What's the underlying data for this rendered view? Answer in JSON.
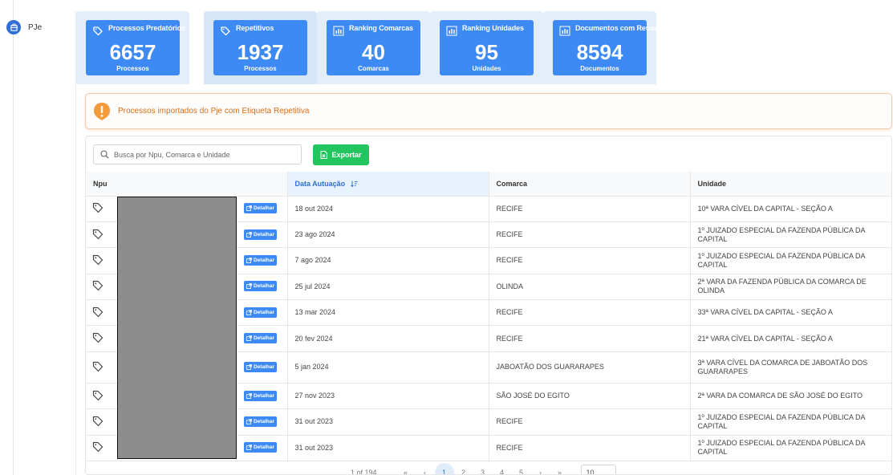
{
  "app": {
    "name": "PJe"
  },
  "tabs": [
    {
      "title": "Processos Predatórios",
      "value": "6657",
      "unit": "Processos",
      "icon": "tag-icon",
      "active": false
    },
    {
      "title": "Repetitivos",
      "value": "1937",
      "unit": "Processos",
      "icon": "tag-icon",
      "active": true
    },
    {
      "title": "Ranking Comarcas",
      "value": "40",
      "unit": "Comarcas",
      "icon": "bar-chart-icon",
      "active": false
    },
    {
      "title": "Ranking Unidades",
      "value": "95",
      "unit": "Unidades",
      "icon": "bar-chart-icon",
      "active": false
    },
    {
      "title": "Documentos com Reuso",
      "value": "8594",
      "unit": "Documentos",
      "icon": "bar-chart-icon",
      "active": false
    }
  ],
  "alert": {
    "text": "Processos importados do Pje com Etiqueta Repetitiva",
    "icon": "exclamation-icon",
    "color": "#d86d17"
  },
  "search": {
    "placeholder": "Busca por Npu, Comarca e Unidade"
  },
  "export_label": "Exportar",
  "table": {
    "columns": [
      "Npu",
      "Data Autuação",
      "Comarca",
      "Unidade"
    ],
    "sorted_column": "Data Autuação",
    "detail_label": "Detalhar",
    "rows": [
      {
        "data": "18 out 2024",
        "comarca": "RECIFE",
        "unidade": "10ª VARA CÍVEL DA CAPITAL - SEÇÃO A"
      },
      {
        "data": "23 ago 2024",
        "comarca": "RECIFE",
        "unidade": "1º JUIZADO ESPECIAL DA FAZENDA PÚBLICA DA CAPITAL"
      },
      {
        "data": "7 ago 2024",
        "comarca": "RECIFE",
        "unidade": "1º JUIZADO ESPECIAL DA FAZENDA PÚBLICA DA CAPITAL"
      },
      {
        "data": "25 jul 2024",
        "comarca": "OLINDA",
        "unidade": "2ª VARA DA FAZENDA PÚBLICA DA COMARCA DE OLINDA"
      },
      {
        "data": "13 mar 2024",
        "comarca": "RECIFE",
        "unidade": "33ª VARA CÍVEL DA CAPITAL - SEÇÃO A"
      },
      {
        "data": "20 fev 2024",
        "comarca": "RECIFE",
        "unidade": "21ª VARA CÍVEL DA CAPITAL - SEÇÃO A"
      },
      {
        "data": "5 jan 2024",
        "comarca": "JABOATÃO DOS GUARARAPES",
        "unidade": "3ª VARA CÍVEL DA COMARCA DE JABOATÃO DOS GUARARAPES"
      },
      {
        "data": "27 nov 2023",
        "comarca": "SÃO JOSÉ DO EGITO",
        "unidade": "2ª VARA DA COMARCA DE SÃO JOSÉ DO EGITO"
      },
      {
        "data": "31 out 2023",
        "comarca": "RECIFE",
        "unidade": "1º JUIZADO ESPECIAL DA FAZENDA PÚBLICA DA CAPITAL"
      },
      {
        "data": "31 out 2023",
        "comarca": "RECIFE",
        "unidade": "1º JUIZADO ESPECIAL DA FAZENDA PÚBLICA DA CAPITAL"
      }
    ]
  },
  "pagination": {
    "info": "1 of 194",
    "first": "«",
    "prev": "‹",
    "pages": [
      "1",
      "2",
      "3",
      "4",
      "5"
    ],
    "current": "1",
    "next": "›",
    "last": "»",
    "page_size": "10"
  },
  "colors": {
    "primary": "#3d8af5",
    "success": "#22c55e",
    "warning": "#d86d17"
  }
}
